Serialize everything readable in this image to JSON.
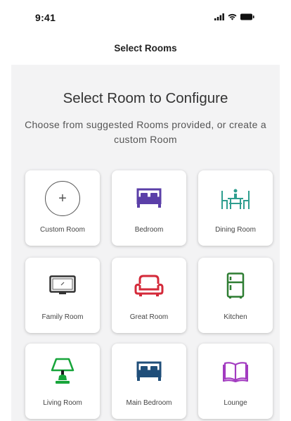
{
  "status_bar": {
    "time": "9:41"
  },
  "nav": {
    "title": "Select Rooms"
  },
  "main": {
    "heading": "Select Room to Configure",
    "subheading": "Choose from suggested Rooms provided, or create a custom Room"
  },
  "rooms": [
    {
      "label": "Custom Room",
      "icon": "plus-icon",
      "color": "#555555"
    },
    {
      "label": "Bedroom",
      "icon": "bed-icon",
      "color": "#5b3fa8"
    },
    {
      "label": "Dining Room",
      "icon": "dining-table-icon",
      "color": "#2f9e8f"
    },
    {
      "label": "Family Room",
      "icon": "tv-icon",
      "color": "#333333"
    },
    {
      "label": "Great Room",
      "icon": "sofa-icon",
      "color": "#d42a3a"
    },
    {
      "label": "Kitchen",
      "icon": "fridge-icon",
      "color": "#2e7d32"
    },
    {
      "label": "Living Room",
      "icon": "lamp-icon",
      "color": "#17a53a"
    },
    {
      "label": "Main Bedroom",
      "icon": "bed-icon",
      "color": "#1f4e79"
    },
    {
      "label": "Lounge",
      "icon": "book-icon",
      "color": "#a23bc0"
    }
  ]
}
